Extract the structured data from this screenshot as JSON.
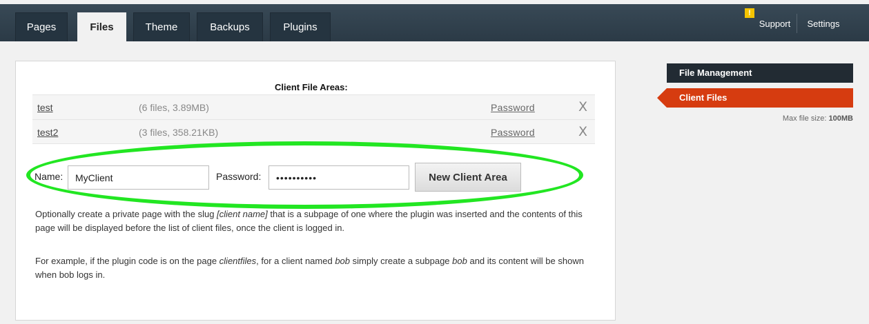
{
  "nav": {
    "tabs": [
      "Pages",
      "Files",
      "Theme",
      "Backups",
      "Plugins"
    ],
    "active_tab": "Files",
    "alert_glyph": "!",
    "support_label": "Support",
    "settings_label": "Settings"
  },
  "main": {
    "title": "Client File Areas:",
    "areas": [
      {
        "name": "test",
        "meta": "(6 files, 3.89MB)",
        "password_label": "Password",
        "delete_label": "X"
      },
      {
        "name": "test2",
        "meta": "(3 files, 358.21KB)",
        "password_label": "Password",
        "delete_label": "X"
      }
    ],
    "form": {
      "name_label": "Name:",
      "name_value": "MyClient",
      "password_label": "Password:",
      "password_value": "••••••••••",
      "button_label": "New Client Area"
    },
    "para1_a": "Optionally create a private page with the slug ",
    "para1_em": "[client name]",
    "para1_b": " that is a subpage of one where the plugin was inserted and the contents of this page will be displayed before the list of client files, once the client is logged in.",
    "para2_a": "For example, if the plugin code is on the page ",
    "para2_em1": "clientfiles",
    "para2_b": ", for a client named ",
    "para2_em2": "bob",
    "para2_c": " simply create a subpage ",
    "para2_em3": "bob",
    "para2_d": " and its content will be shown when bob logs in."
  },
  "sidebar": {
    "heading": "File Management",
    "item": "Client Files",
    "max_label": "Max file size: ",
    "max_value": "100MB"
  },
  "colors": {
    "accent": "#d63c10",
    "highlight": "#22e622",
    "header": "#2b3a46"
  }
}
